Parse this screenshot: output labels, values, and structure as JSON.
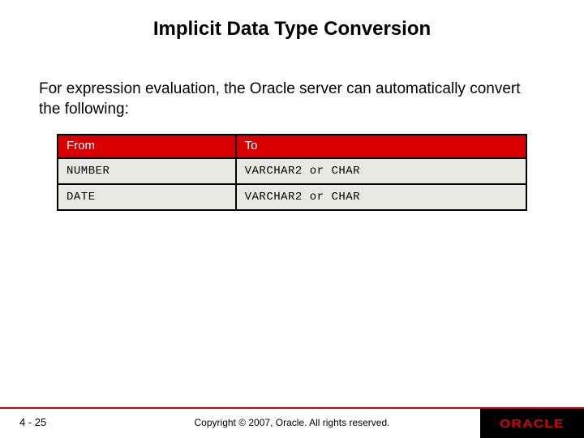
{
  "title": "Implicit Data Type Conversion",
  "intro": "For expression evaluation, the Oracle server can automatically convert the following:",
  "table": {
    "headers": {
      "from": "From",
      "to": "To"
    },
    "rows": [
      {
        "from": "NUMBER",
        "to": "VARCHAR2 or CHAR"
      },
      {
        "from": "DATE",
        "to": "VARCHAR2 or CHAR"
      }
    ]
  },
  "footer": {
    "page": "4 - 25",
    "copyright": "Copyright © 2007, Oracle. All rights reserved.",
    "logo": "ORACLE"
  }
}
